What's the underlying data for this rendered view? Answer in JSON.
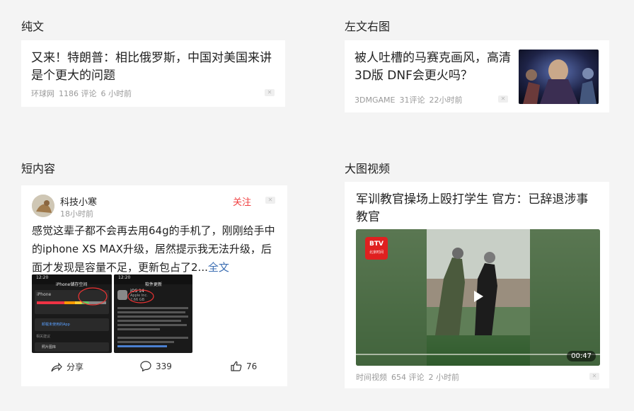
{
  "sections": {
    "plain": "纯文",
    "left_text_right_image": "左文右图",
    "short_content": "短内容",
    "big_video": "大图视频"
  },
  "plain_card": {
    "title": "又来！特朗普：相比俄罗斯，中国对美国来讲是个更大的问题",
    "source": "环球网",
    "comments": "1186 评论",
    "time": "6 小时前"
  },
  "image_card": {
    "title": "被人吐槽的马赛克画风，高清 3D版 DNF会更火吗？",
    "source": "3DMGAME",
    "comments": "31评论",
    "time": "22小时前"
  },
  "short_card": {
    "author": "科技小寒",
    "time": "18小时前",
    "follow": "关注",
    "text": "感觉这辈子都不会再去用64g的手机了，刚刚给手中的iphone XS MAX升级，居然提示我无法升级，后面才发现是容量不足，更新包占了2...",
    "full_text_link": "全文",
    "screenshot_1": {
      "header_time": "12:20",
      "header_title": "iPhone储存空间",
      "row1": "iPhone",
      "row2": "卸载未使用的App",
      "row3": "相关建议",
      "row4": "照片图库"
    },
    "screenshot_2": {
      "header_time": "12:20",
      "header_title": "软件更新",
      "ios": "iOS 14",
      "vendor": "Apple Inc.",
      "size": "2.66 GB"
    },
    "share": "分享",
    "comments": "339",
    "likes": "76"
  },
  "video_card": {
    "title": "军训教官操场上殴打学生 官方：已辞退涉事教官",
    "watermark": "BTV",
    "watermark_sub": "北京时间",
    "duration": "00:47",
    "source": "时间视频",
    "comments": "654 评论",
    "time": "2 小时前"
  }
}
